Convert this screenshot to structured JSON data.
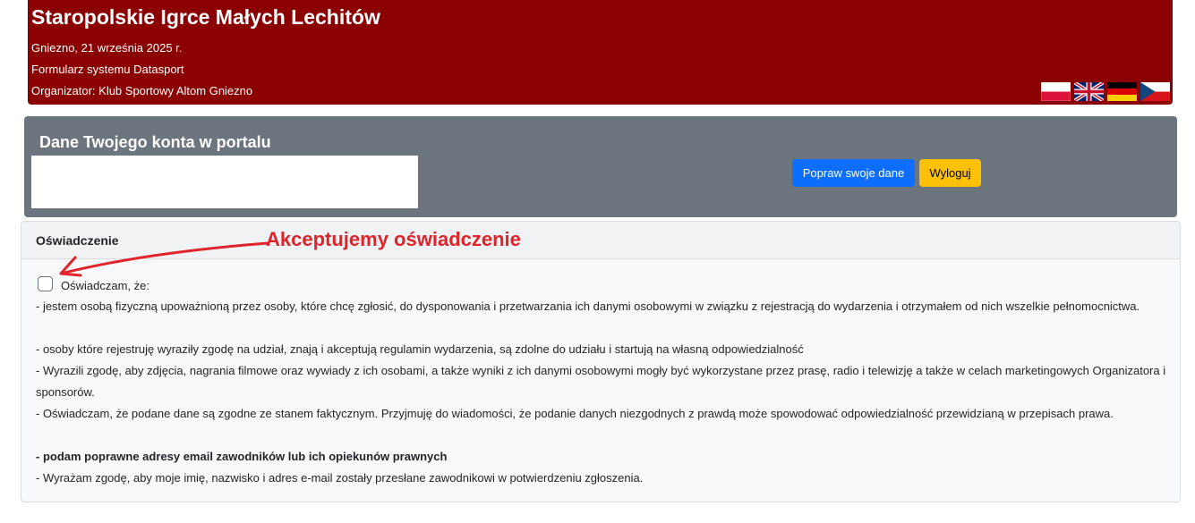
{
  "header": {
    "title": "Staropolskie Igrce Małych Lechitów",
    "date": "Gniezno, 21 września 2025 r.",
    "form": "Formularz systemu Datasport",
    "organizer": "Organizator: Klub Sportowy Altom Gniezno",
    "flags": [
      "pl-flag-icon",
      "gb-flag-icon",
      "de-flag-icon",
      "cz-flag-icon"
    ]
  },
  "account": {
    "title": "Dane Twojego konta w portalu",
    "edit_button": "Popraw swoje dane",
    "logout_button": "Wyloguj"
  },
  "declaration": {
    "header": "Oświadczenie",
    "annotation": "Akceptujemy oświadczenie",
    "checkbox_label": "Oświadczam, że:",
    "p1": "- jestem osobą fizyczną upoważnioną przez osoby, które chcę zgłosić, do dysponowania i przetwarzania ich danymi osobowymi w związku z rejestracją do wydarzenia i otrzymałem od nich wszelkie pełnomocnictwa.",
    "p2": "- osoby które rejestruję wyraziły zgodę na udział, znają i akceptują regulamin wydarzenia, są zdolne do udziału i startują na własną odpowiedzialność",
    "p3": "- Wyrazili zgodę, aby zdjęcia, nagrania filmowe oraz wywiady z ich osobami, a także wyniki z ich danymi osobowymi mogły być wykorzystane przez prasę, radio i telewizję a także w celach marketingowych Organizatora i sponsorów.",
    "p4": "- Oświadczam, że podane dane są zgodne ze stanem faktycznym. Przyjmuję do wiadomości, że podanie danych niezgodnych z prawdą może spowodować odpowiedzialność przewidzianą w przepisach prawa.",
    "p5": "- podam poprawne adresy email zawodników lub ich opiekunów prawnych",
    "p6": "- Wyrażam zgodę, aby moje imię, nazwisko i adres e-mail zostały przesłane zawodnikowi w potwierdzeniu zgłoszenia."
  },
  "colors": {
    "header_bg": "#8b0000",
    "account_bg": "#6c757d",
    "primary": "#0d6efd",
    "warning": "#ffc107",
    "annotation": "#e0242b"
  }
}
